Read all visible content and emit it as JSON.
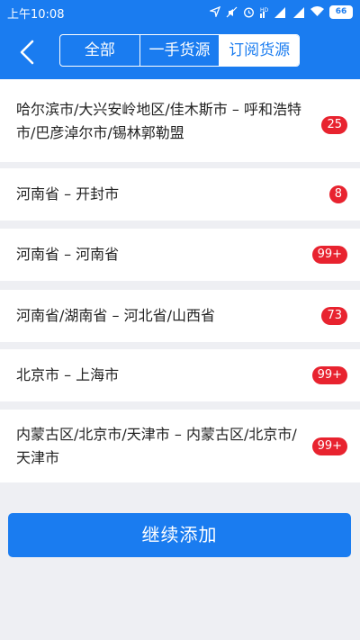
{
  "status_bar": {
    "time": "上午10:08",
    "battery": "66"
  },
  "header": {
    "back_icon": "chevron-left-icon",
    "tabs": [
      {
        "label": "全部",
        "active": false
      },
      {
        "label": "一手货源",
        "active": false
      },
      {
        "label": "订阅货源",
        "active": true
      }
    ]
  },
  "subscriptions": [
    {
      "route": "哈尔滨市/大兴安岭地区/佳木斯市 – 呼和浩特市/巴彦淖尔市/锡林郭勒盟",
      "count": "25"
    },
    {
      "route": "河南省 – 开封市",
      "count": "8"
    },
    {
      "route": "河南省 – 河南省",
      "count": "99+"
    },
    {
      "route": "河南省/湖南省 – 河北省/山西省",
      "count": "73"
    },
    {
      "route": "北京市 – 上海市",
      "count": "99+"
    },
    {
      "route": "内蒙古区/北京市/天津市 – 内蒙古区/北京市/天津市",
      "count": "99+"
    }
  ],
  "add_button": "继续添加",
  "colors": {
    "primary": "#1a7cf0",
    "badge": "#e8232f",
    "background": "#eeeff3"
  }
}
